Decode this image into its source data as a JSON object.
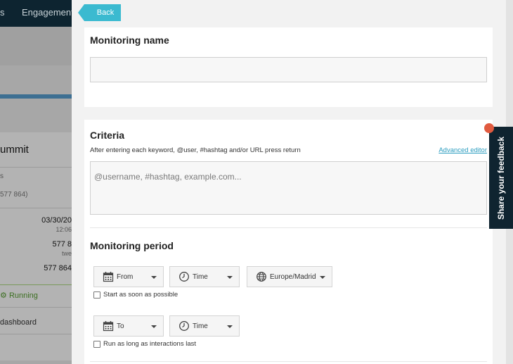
{
  "background": {
    "nav_partial": "s",
    "nav_engagement": "Engagement",
    "title_partial": "ummit",
    "meta_partial": "s",
    "count_partial": "577 864)",
    "date_partial": "03/30/20",
    "time_partial": "12:06",
    "value_a_partial": "577 8",
    "value_a_sub": "twe",
    "value_b_partial": "577 864",
    "status": "Running",
    "dashboard_link": "dashboard"
  },
  "back_label": "Back",
  "monitoring_name": {
    "title": "Monitoring name",
    "value": ""
  },
  "criteria": {
    "title": "Criteria",
    "hint": "After entering each keyword, @user, #hashtag and/or URL press return",
    "advanced_editor": "Advanced editor",
    "placeholder": "@username, #hashtag, example.com..."
  },
  "monitoring_period": {
    "title": "Monitoring period",
    "from_label": "From",
    "time_label": "Time",
    "timezone": "Europe/Madrid",
    "start_asap": "Start as soon as possible",
    "to_label": "To",
    "run_long": "Run as long as interactions last"
  },
  "feedback_label": "Share your feedback",
  "colors": {
    "accent": "#3bbad0",
    "dark": "#0f2430",
    "notification": "#e05a3f",
    "link": "#2a9cbf"
  }
}
